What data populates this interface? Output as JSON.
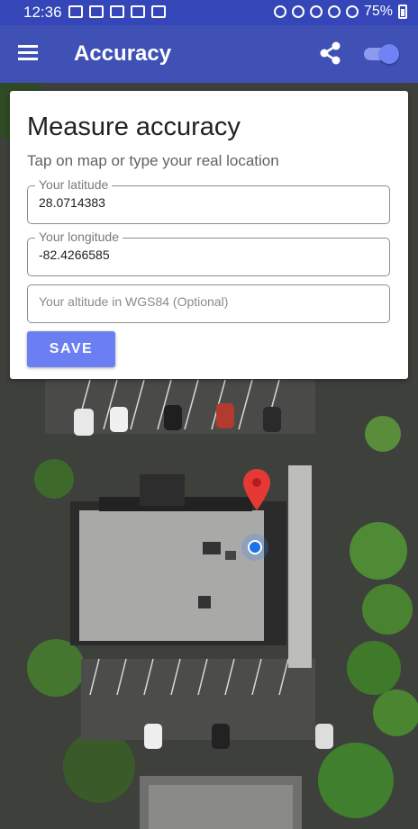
{
  "status_bar": {
    "time": "12:36",
    "battery": "75%"
  },
  "app_bar": {
    "title": "Accuracy",
    "accent": "#3f51b5"
  },
  "card": {
    "title": "Measure accuracy",
    "subtitle": "Tap on map or type your real location",
    "latitude": {
      "label": "Your latitude",
      "value": "28.0714383"
    },
    "longitude": {
      "label": "Your longitude",
      "value": "-82.4266585"
    },
    "altitude": {
      "placeholder": "Your altitude in WGS84 (Optional)"
    },
    "save_label": "SAVE",
    "save_color": "#6c7ff2"
  },
  "map": {
    "marker_color": "#e53935",
    "location_dot_color": "#1a73e8"
  }
}
